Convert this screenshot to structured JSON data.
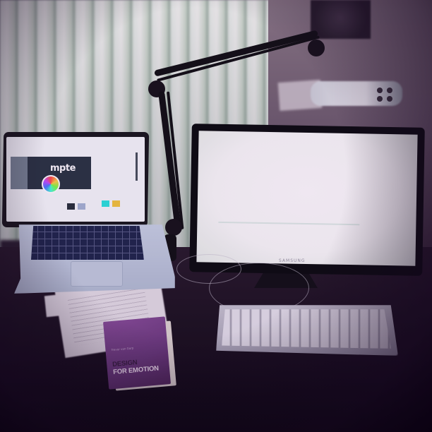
{
  "photo": {
    "laptop_app_title": "mpte",
    "monitor_brand": "SAMSUNG",
    "book_author": "Trevor van Gorp",
    "book_title_line1": "DESIGN",
    "book_title_line2": "FOR EMOTION"
  },
  "palette": {
    "swatches": [
      "#2b3040",
      "#a8b6d6",
      "#2ee6e0",
      "#f4c742"
    ]
  }
}
